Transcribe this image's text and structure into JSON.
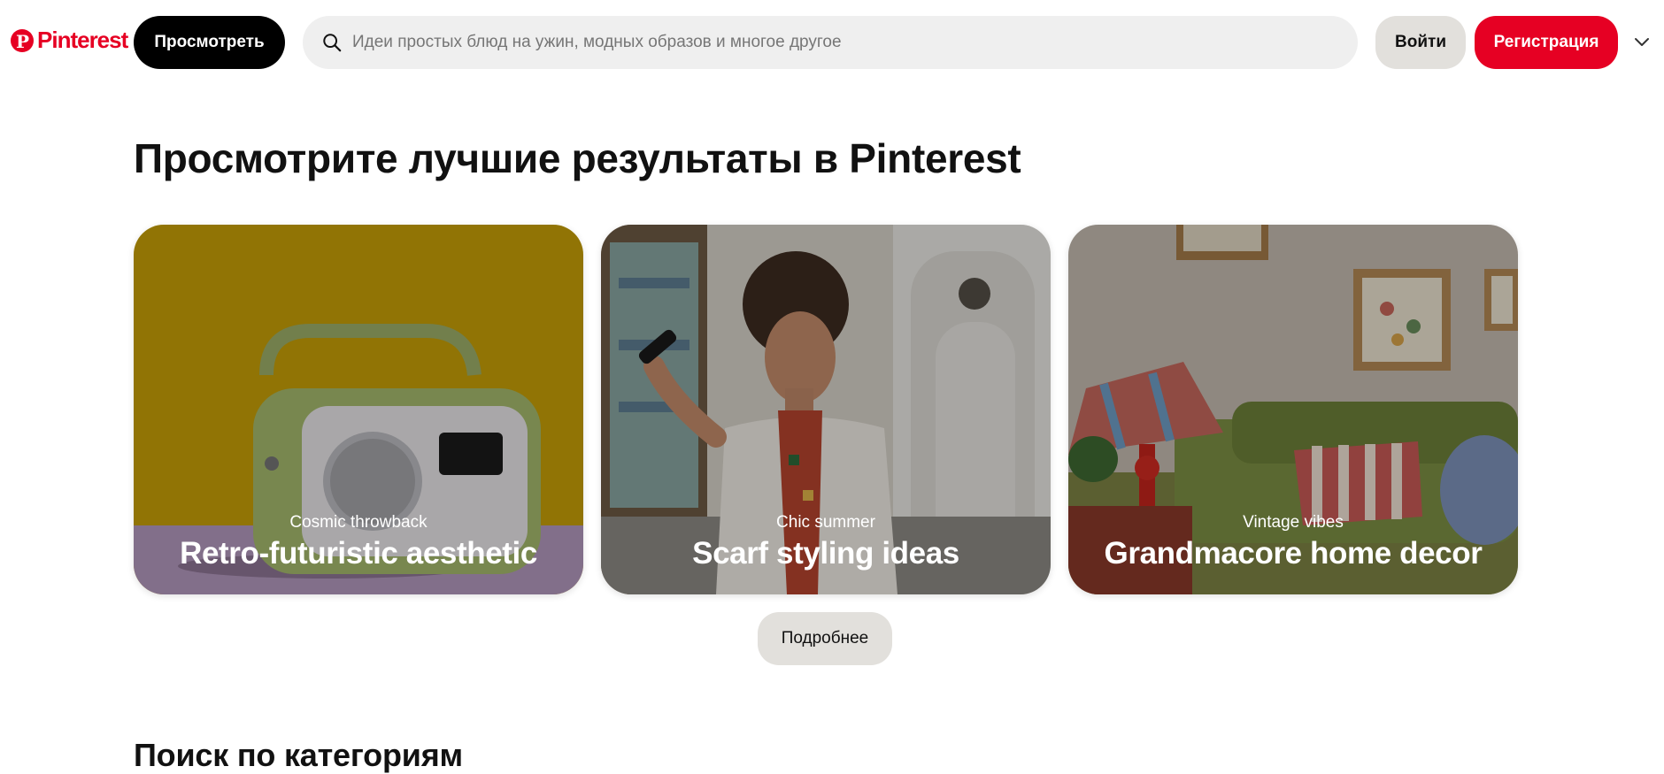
{
  "header": {
    "logo_text": "Pinterest",
    "explore_label": "Просмотреть",
    "search": {
      "placeholder": "Идеи простых блюд на ужин, модных образов и многое другое",
      "value": ""
    },
    "login_label": "Войти",
    "signup_label": "Регистрация",
    "brand_color": "#e60023"
  },
  "main": {
    "title": "Просмотрите лучшие результаты в Pinterest",
    "cards": [
      {
        "kicker": "Cosmic throwback",
        "headline": "Retro-futuristic aesthetic"
      },
      {
        "kicker": "Chic summer",
        "headline": "Scarf styling ideas"
      },
      {
        "kicker": "Vintage vibes",
        "headline": "Grandmacore home decor"
      }
    ],
    "details_label": "Подробнее",
    "categories_title": "Поиск по категориям"
  }
}
